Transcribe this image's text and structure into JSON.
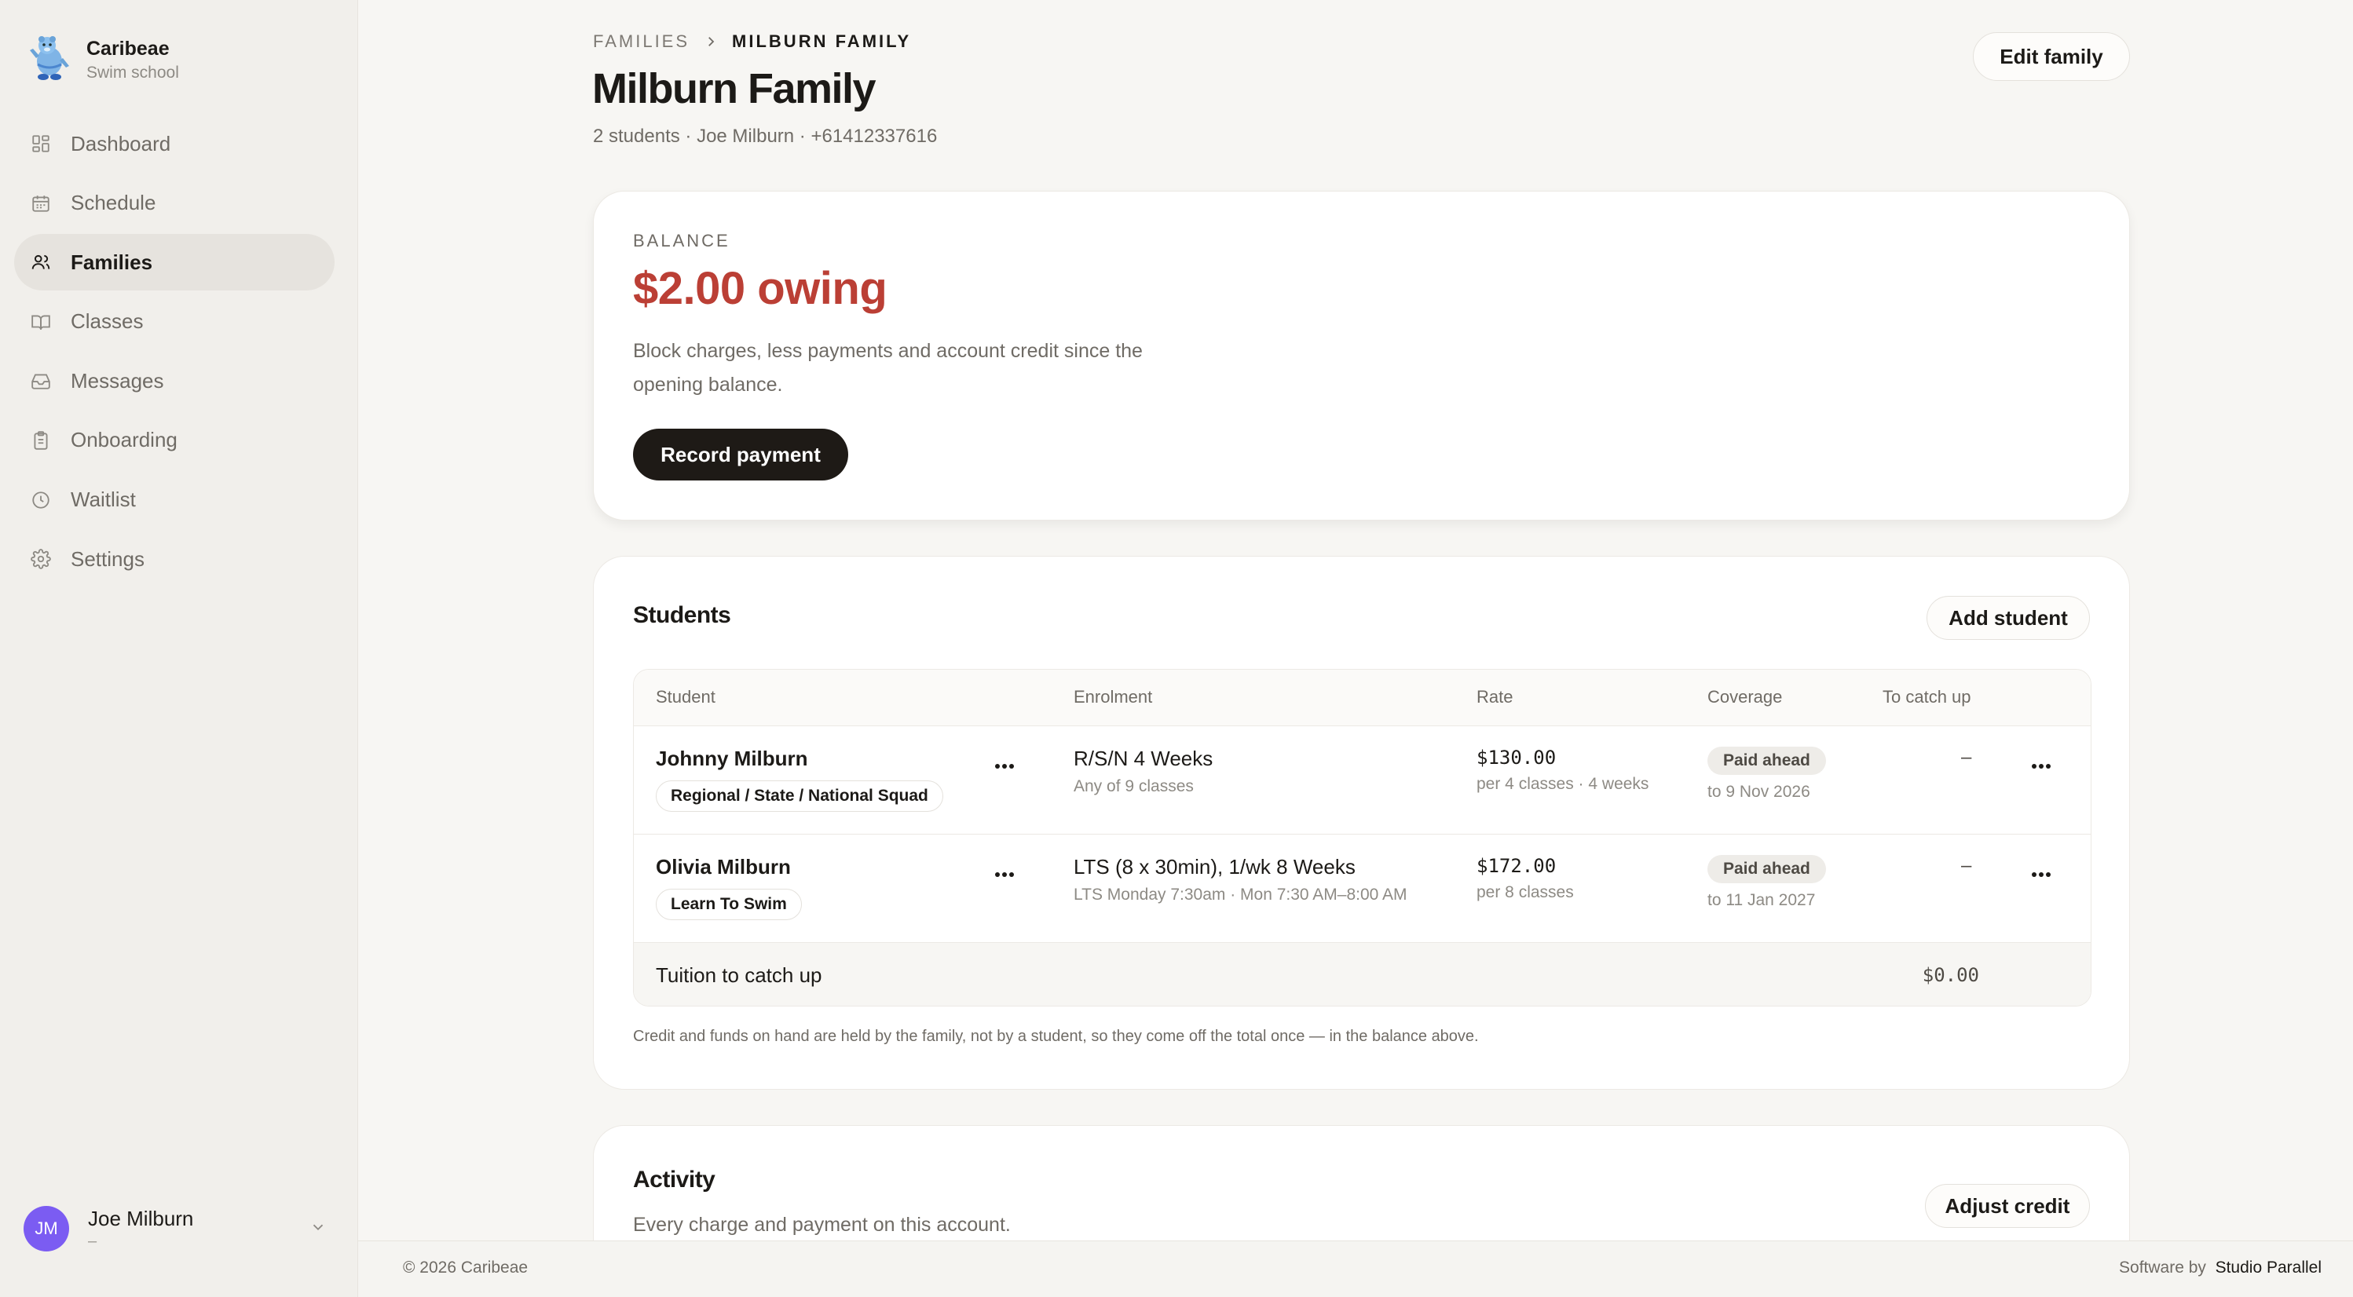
{
  "brand": {
    "name": "Caribeae",
    "subtitle": "Swim school"
  },
  "sidebar": {
    "items": [
      {
        "label": "Dashboard",
        "icon": "dashboard-icon"
      },
      {
        "label": "Schedule",
        "icon": "calendar-icon"
      },
      {
        "label": "Families",
        "icon": "users-icon",
        "active": true
      },
      {
        "label": "Classes",
        "icon": "book-icon"
      },
      {
        "label": "Messages",
        "icon": "inbox-icon"
      },
      {
        "label": "Onboarding",
        "icon": "clipboard-icon"
      },
      {
        "label": "Waitlist",
        "icon": "clock-icon"
      },
      {
        "label": "Settings",
        "icon": "gear-icon"
      }
    ]
  },
  "user": {
    "initials": "JM",
    "name": "Joe Milburn",
    "sub": "–"
  },
  "header": {
    "breadcrumb_root": "FAMILIES",
    "breadcrumb_current": "MILBURN FAMILY",
    "title": "Milburn Family",
    "subtitle": "2 students · Joe Milburn · +61412337616",
    "edit_label": "Edit family"
  },
  "balance": {
    "label": "BALANCE",
    "amount": "$2.00 owing",
    "description": "Block charges, less payments and account credit since the opening balance.",
    "record_label": "Record payment",
    "accent_color": "#bb3f35"
  },
  "students": {
    "title": "Students",
    "add_label": "Add student",
    "columns": [
      "Student",
      "Enrolment",
      "Rate",
      "Coverage",
      "To catch up"
    ],
    "rows": [
      {
        "name": "Johnny Milburn",
        "tag": "Regional / State / National Squad",
        "enrolment": "R/S/N 4 Weeks",
        "enrolment_detail": "Any of 9 classes",
        "rate": "$130.00",
        "rate_detail": "per 4 classes · 4 weeks",
        "coverage": "Paid ahead",
        "coverage_date": "to 9 Nov 2026",
        "catch_up": "–"
      },
      {
        "name": "Olivia Milburn",
        "tag": "Learn To Swim",
        "enrolment": "LTS (8 x 30min), 1/wk 8 Weeks",
        "enrolment_detail": "LTS Monday 7:30am · Mon 7:30 AM–8:00 AM",
        "rate": "$172.00",
        "rate_detail": "per 8 classes",
        "coverage": "Paid ahead",
        "coverage_date": "to 11 Jan 2027",
        "catch_up": "–"
      }
    ],
    "footer_label": "Tuition to catch up",
    "footer_value": "$0.00",
    "footnote": "Credit and funds on hand are held by the family, not by a student, so they come off the total once — in the balance above."
  },
  "activity": {
    "title": "Activity",
    "subtitle": "Every charge and payment on this account.",
    "adjust_label": "Adjust credit"
  },
  "footer": {
    "copyright": "© 2026 Caribeae",
    "software_prefix": "Software by",
    "software_name": "Studio Parallel"
  }
}
